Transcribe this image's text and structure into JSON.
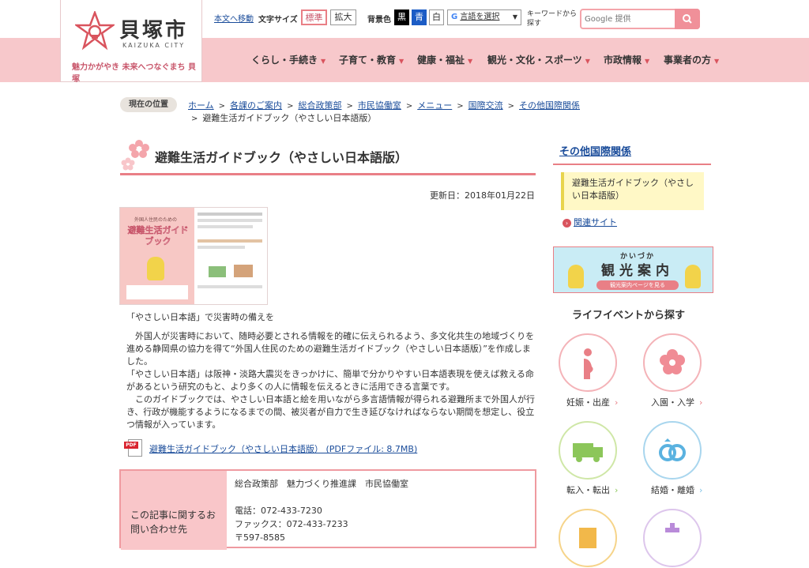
{
  "header": {
    "city_name": "貝塚市",
    "city_name_en": "KAIZUKA CITY",
    "tagline": "魅力かがやき 未来へつなぐまち 貝塚",
    "skip": "本文へ移動",
    "font_size_label": "文字サイズ",
    "font_standard": "標準",
    "font_large": "拡大",
    "bg_label": "背景色",
    "bg_black": "黒",
    "bg_blue": "青",
    "bg_white": "白",
    "lang_select": "言語を選択",
    "search_label": "キーワードから探す",
    "search_placeholder": "Google 提供"
  },
  "nav": [
    "くらし・手続き",
    "子育て・教育",
    "健康・福祉",
    "観光・文化・スポーツ",
    "市政情報",
    "事業者の方"
  ],
  "breadcrumb": {
    "label": "現在の位置",
    "items": [
      "ホーム",
      "各課のご案内",
      "総合政策部",
      "市民協働室",
      "メニュー",
      "国際交流",
      "その他国際関係"
    ],
    "current": "避難生活ガイドブック（やさしい日本語版）"
  },
  "article": {
    "title": "避難生活ガイドブック（やさしい日本語版）",
    "updated": "更新日：2018年01月22日",
    "thumb_title_small": "外国人住民のための",
    "thumb_title": "避難生活ガイドブック",
    "caption": "「やさしい日本語」で災害時の備えを",
    "para1": "　外国人が災害時において、随時必要とされる情報を的確に伝えられるよう、多文化共生の地域づくりを進める静岡県の協力を得て“外国人住民のための避難生活ガイドブック（やさしい日本語版）”を作成しました。",
    "para2": "「やさしい日本語」は阪神・淡路大震災をきっかけに、簡単で分かりやすい日本語表現を使えば救える命があるという研究のもと、より多くの人に情報を伝えるときに活用できる言葉です。",
    "para3": "　このガイドブックでは、やさしい日本語と絵を用いながら多言語情報が得られる避難所まで外国人が行き、行政が機能するようになるまでの間、被災者が自力で生き延びなければならない期間を想定し、役立つ情報が入っています。",
    "pdf_link": "避難生活ガイドブック（やさしい日本語版） (PDFファイル: 8.7MB)",
    "pdf_icon_text": "PDF"
  },
  "contact": {
    "label": "この記事に関するお問い合わせ先",
    "dept": "総合政策部　魅力づくり推進課　市民協働室",
    "tel": "電話：072-433-7230",
    "fax": "ファックス：072-433-7233",
    "zip": "〒597-8585"
  },
  "side": {
    "heading": "その他国際関係",
    "item": "避難生活ガイドブック（やさしい日本語版）",
    "related": "関連サイト",
    "banner_kana": "かいづか",
    "banner_title": "観光案内",
    "banner_btn": "観光案内ページを見る",
    "life_heading": "ライフイベントから探す",
    "life": [
      "妊娠・出産",
      "入園・入学",
      "転入・転出",
      "結婚・離婚"
    ]
  },
  "colors": {
    "pink_band": "#f7c8cb",
    "accent": "#e97f86",
    "link": "#1a4c9a"
  }
}
